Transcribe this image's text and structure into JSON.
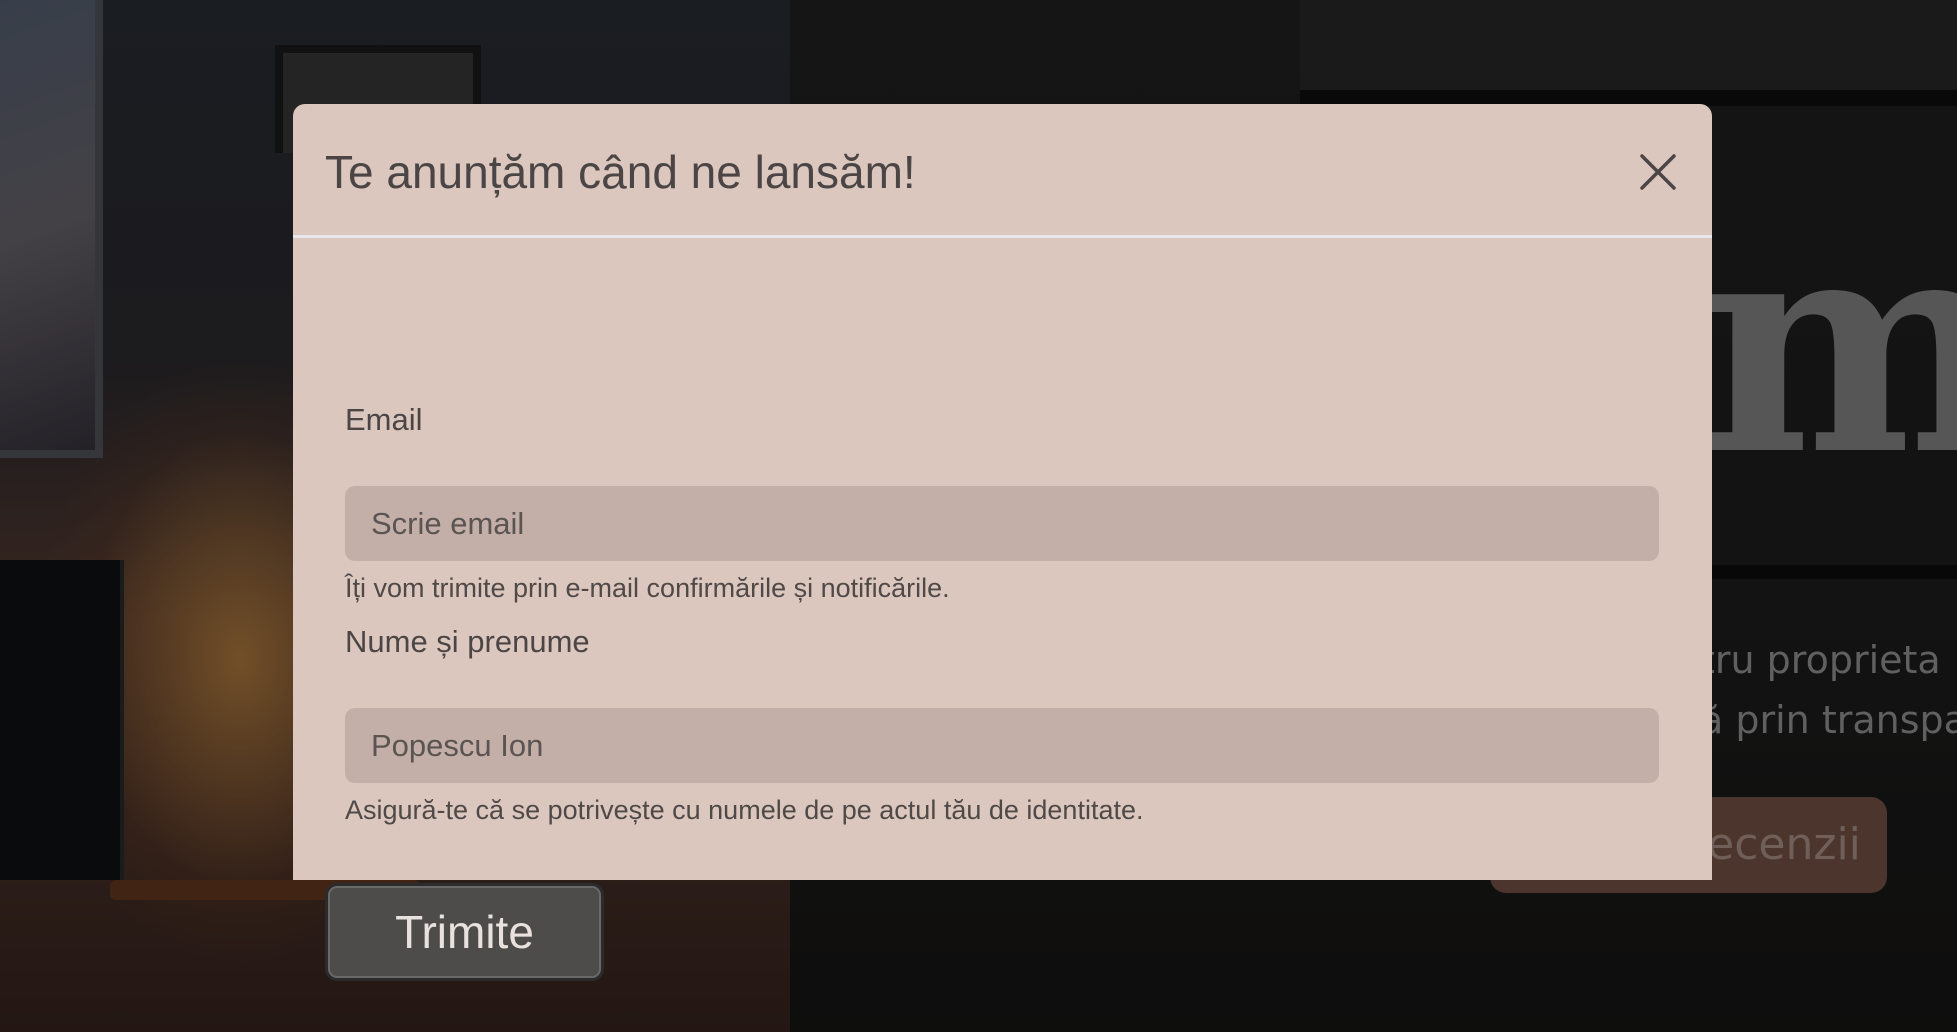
{
  "background": {
    "big_letter": "m",
    "tagline_line1": "tru proprieta",
    "tagline_line2": "ă prin transpa",
    "pill_button_label": "recenzii"
  },
  "modal": {
    "title": "Te anunțăm când ne lansăm!",
    "close_icon": "close-icon",
    "fields": {
      "email": {
        "label": "Email",
        "placeholder": "Scrie email",
        "value": "",
        "help": "Îți vom trimite prin e-mail confirmările și notificările."
      },
      "name": {
        "label": "Nume și prenume",
        "placeholder": "Popescu Ion",
        "value": "",
        "help": "Asigură-te că se potrivește cu numele de pe actul tău de identitate."
      }
    },
    "submit_label": "Trimite"
  },
  "colors": {
    "modal_background": "#dcc7bf",
    "input_background": "#c4afa8",
    "button_background": "#4d4c4b",
    "text": "#4b4645"
  }
}
